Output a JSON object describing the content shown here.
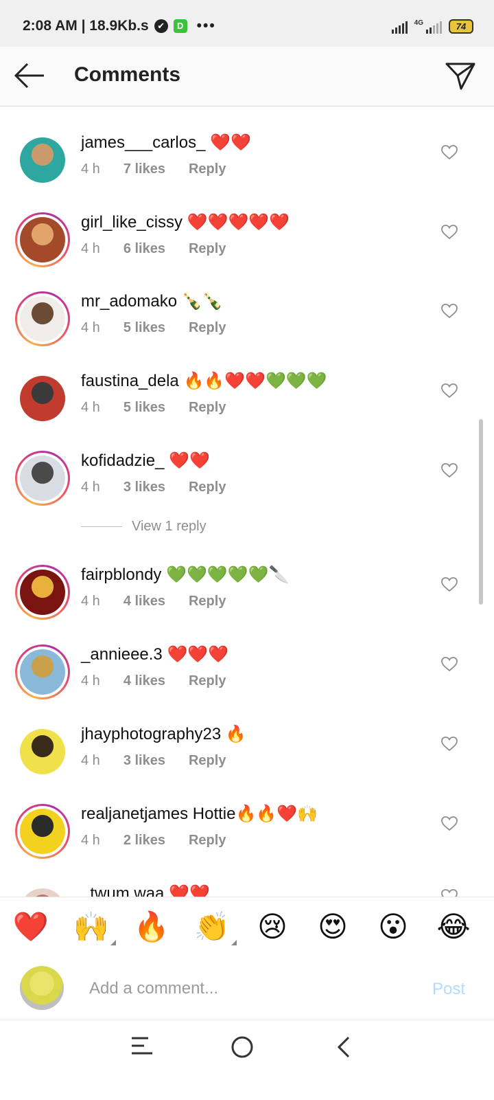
{
  "status": {
    "time_speed": "2:08 AM | 18.9Kb.s",
    "check_glyph": "✔",
    "app_glyph": "D",
    "dots": "•••",
    "net_label": "4G",
    "battery": "74"
  },
  "header": {
    "title": "Comments",
    "back_icon": "arrow-left-icon",
    "send_icon": "direct-send-icon"
  },
  "comments": [
    {
      "username": "james___carlos_",
      "text": "❤️❤️",
      "time": "4 h",
      "likes": "7 likes",
      "reply": "Reply",
      "avatar_colors": [
        "#2ea7a0",
        "#c99a6a"
      ],
      "story_ring": false
    },
    {
      "username": "girl_like_cissy",
      "text": "❤️❤️❤️❤️❤️",
      "time": "4 h",
      "likes": "6 likes",
      "reply": "Reply",
      "avatar_colors": [
        "#a24a2a",
        "#e2a46a"
      ],
      "story_ring": true
    },
    {
      "username": "mr_adomako",
      "text": "🍾🍾",
      "time": "4 h",
      "likes": "5 likes",
      "reply": "Reply",
      "avatar_colors": [
        "#f0ede8",
        "#6b4a36"
      ],
      "story_ring": true
    },
    {
      "username": "faustina_dela",
      "text": "🔥🔥❤️❤️💚💚💚",
      "time": "4 h",
      "likes": "5 likes",
      "reply": "Reply",
      "avatar_colors": [
        "#c23b2f",
        "#3a3a3a"
      ],
      "story_ring": false
    },
    {
      "username": "kofidadzie_",
      "text": "❤️❤️",
      "time": "4 h",
      "likes": "3 likes",
      "reply": "Reply",
      "avatar_colors": [
        "#d8dde3",
        "#4a4a4a"
      ],
      "story_ring": true
    },
    {
      "username": "fairpblondy",
      "text": "💚💚💚💚💚🔪",
      "time": "4 h",
      "likes": "4 likes",
      "reply": "Reply",
      "avatar_colors": [
        "#7a1410",
        "#e8b13c"
      ],
      "story_ring": true
    },
    {
      "username": "_annieee.3",
      "text": "❤️❤️❤️",
      "time": "4 h",
      "likes": "4 likes",
      "reply": "Reply",
      "avatar_colors": [
        "#8ab8d8",
        "#c9a14a"
      ],
      "story_ring": true
    },
    {
      "username": "jhayphotography23",
      "text": "🔥",
      "time": "4 h",
      "likes": "3 likes",
      "reply": "Reply",
      "avatar_colors": [
        "#f0e04a",
        "#3a2a1a"
      ],
      "story_ring": false
    },
    {
      "username": "realjanetjames",
      "text": "Hottie🔥🔥❤️🙌",
      "time": "4 h",
      "likes": "2 likes",
      "reply": "Reply",
      "avatar_colors": [
        "#f2d21e",
        "#2a2a2a"
      ],
      "story_ring": true
    },
    {
      "username": "_twum.waa",
      "text": "❤️❤️",
      "time": "",
      "likes": "",
      "reply": "",
      "avatar_colors": [
        "#e8d2c8",
        "#b5796a"
      ],
      "story_ring": false
    }
  ],
  "view_reply": "View 1 reply",
  "emoji_bar": [
    {
      "glyph": "❤️",
      "name": "red-heart",
      "more": false
    },
    {
      "glyph": "🙌",
      "name": "raising-hands",
      "more": true
    },
    {
      "glyph": "🔥",
      "name": "fire",
      "more": false
    },
    {
      "glyph": "👏",
      "name": "clapping-hands",
      "more": true
    },
    {
      "glyph": "😢",
      "name": "crying-face",
      "more": false
    },
    {
      "glyph": "😍",
      "name": "heart-eyes",
      "more": false
    },
    {
      "glyph": "😮",
      "name": "surprised-face",
      "more": false
    },
    {
      "glyph": "😂",
      "name": "tears-of-joy",
      "more": false
    }
  ],
  "composer": {
    "placeholder": "Add a comment...",
    "post_label": "Post"
  },
  "colors": {
    "meta_gray": "#8e8e8e",
    "post_disabled": "#b3dbff",
    "story_ring": [
      "#f7b04a",
      "#e84a6b",
      "#b02fa7"
    ]
  }
}
